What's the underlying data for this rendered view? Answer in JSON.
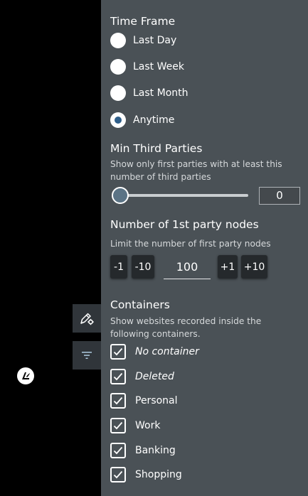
{
  "time_frame": {
    "title": "Time Frame",
    "options": [
      {
        "label": "Last Day",
        "selected": false
      },
      {
        "label": "Last Week",
        "selected": false
      },
      {
        "label": "Last Month",
        "selected": false
      },
      {
        "label": "Anytime",
        "selected": true
      }
    ]
  },
  "min_third_parties": {
    "title": "Min Third Parties",
    "description": "Show only first parties with at least this number of third parties",
    "value": "0"
  },
  "first_party_nodes": {
    "title": "Number of 1st party nodes",
    "description": "Limit the number of first party nodes",
    "buttons": {
      "minus_1": "-1",
      "minus_10": "-10",
      "plus_1": "+1",
      "plus_10": "+10"
    },
    "value": "100"
  },
  "containers": {
    "title": "Containers",
    "description": "Show websites recorded inside the following containers.",
    "items": [
      {
        "label": "No container",
        "checked": true
      },
      {
        "label": "Deleted",
        "checked": true
      },
      {
        "label": "Personal",
        "checked": true
      },
      {
        "label": "Work",
        "checked": true
      },
      {
        "label": "Banking",
        "checked": true
      },
      {
        "label": "Shopping",
        "checked": true
      }
    ]
  },
  "side_toolbar": {
    "icons": [
      "settings-pencil-icon",
      "filter-icon"
    ]
  },
  "colors": {
    "panel_bg": "#4a5156",
    "radio_dot": "#2f5f8a",
    "button_bg": "#25292c",
    "slider_thumb": "#5b7385"
  }
}
